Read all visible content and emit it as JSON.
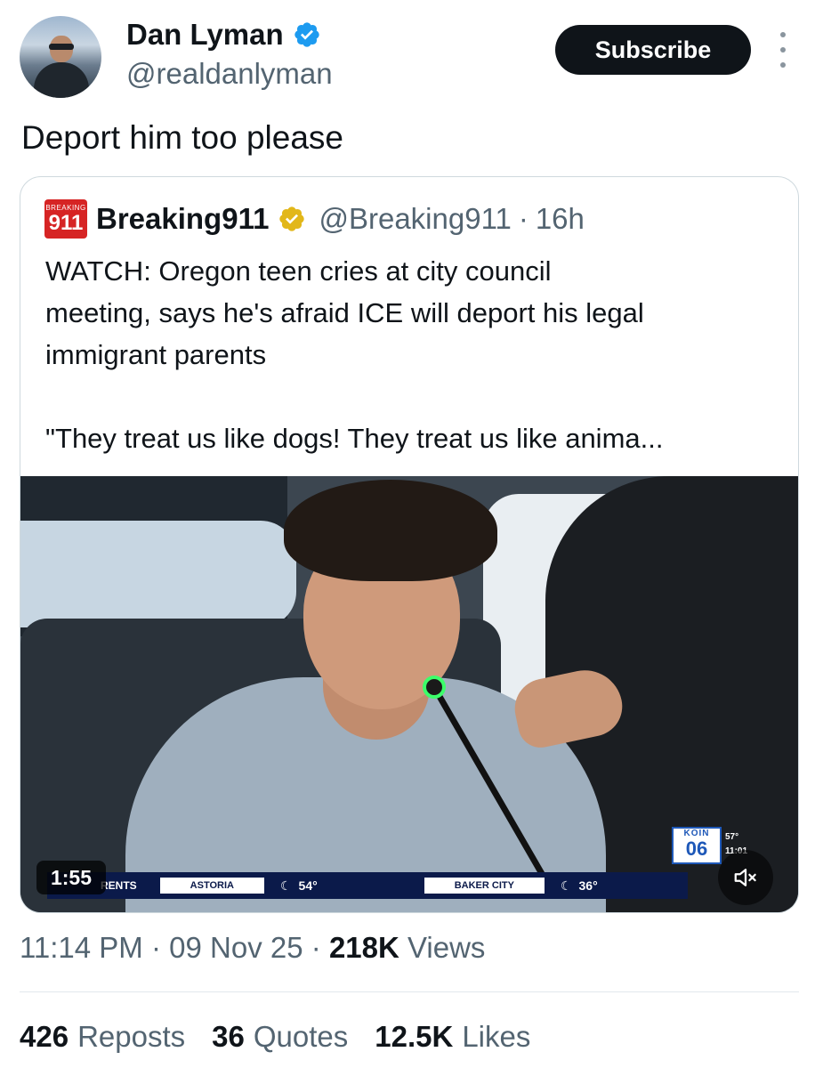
{
  "author": {
    "name": "Dan Lyman",
    "handle": "@realdanlyman"
  },
  "actions": {
    "subscribe_label": "Subscribe"
  },
  "tweet": {
    "text": "Deport him too please"
  },
  "quoted": {
    "logo_small": "BREAKING",
    "logo_big": "911",
    "name": "Breaking911",
    "handle": "@Breaking911",
    "separator": "·",
    "age": "16h",
    "text_lines": [
      "WATCH: Oregon teen cries at city council",
      "meeting, says he's afraid ICE will deport his legal",
      "immigrant parents",
      "\"They treat us like dogs! They treat us like anima..."
    ],
    "video": {
      "duration": "1:55",
      "ticker_label": "RENTS",
      "cities": [
        {
          "name": "ASTORIA",
          "temp": "54°"
        },
        {
          "name": "BAKER CITY",
          "temp": "36°"
        }
      ],
      "station_top": "KOIN",
      "station_num": "06",
      "station_temp": "57°",
      "station_time": "11:01"
    }
  },
  "timestamp": {
    "time": "11:14 PM",
    "sep1": "·",
    "date": "09 Nov 25",
    "sep2": "·",
    "views_count": "218K",
    "views_label": "Views"
  },
  "stats": {
    "reposts_count": "426",
    "reposts_label": "Reposts",
    "quotes_count": "36",
    "quotes_label": "Quotes",
    "likes_count": "12.5K",
    "likes_label": "Likes"
  },
  "colors": {
    "verified_blue": "#1d9bf0",
    "verified_gold": "#e2b719",
    "muted_text": "#536471"
  }
}
